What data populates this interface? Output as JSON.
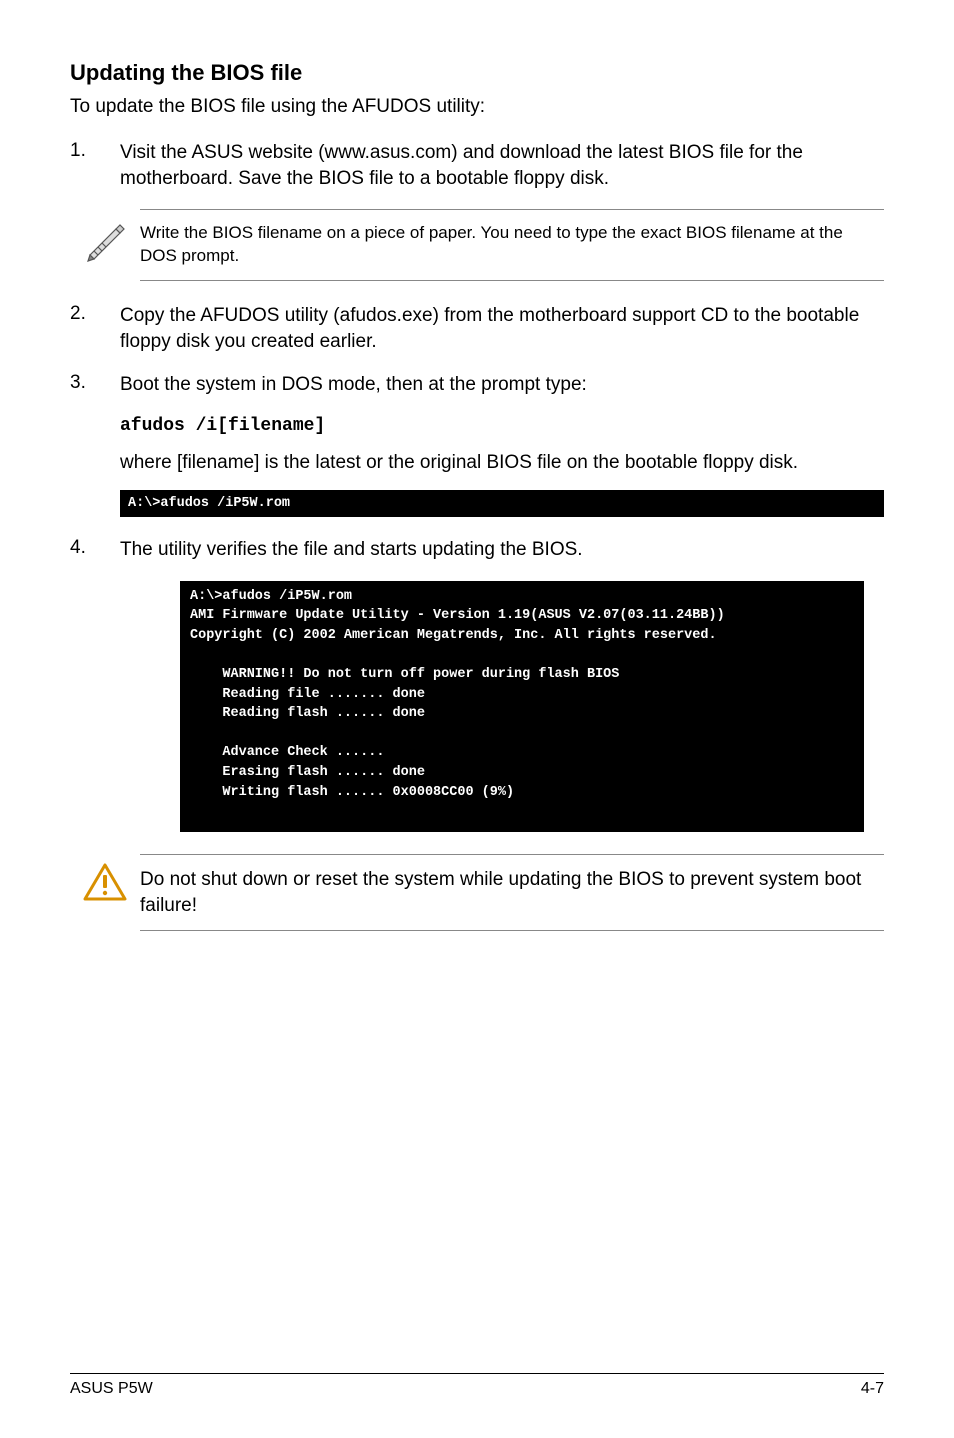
{
  "heading": "Updating the BIOS file",
  "intro": "To update the BIOS file using the AFUDOS utility:",
  "step1": {
    "num": "1.",
    "text": "Visit the ASUS website (www.asus.com) and download the latest BIOS file for the motherboard. Save the BIOS file to a bootable floppy disk."
  },
  "note1": "Write the BIOS filename on a piece of paper. You need to type the exact BIOS filename at the DOS prompt.",
  "step2": {
    "num": "2.",
    "text": "Copy the AFUDOS utility (afudos.exe) from the motherboard support CD to the bootable floppy disk you created earlier."
  },
  "step3": {
    "num": "3.",
    "text": "Boot the system in DOS mode, then at the prompt type:"
  },
  "code1": "afudos /i[filename]",
  "step3b": "where [filename] is the latest or the original BIOS file on the bootable floppy disk.",
  "terminal1": "A:\\>afudos /iP5W.rom",
  "step4": {
    "num": "4.",
    "text": "The utility verifies the file and starts updating the BIOS."
  },
  "terminal2": "A:\\>afudos /iP5W.rom\nAMI Firmware Update Utility - Version 1.19(ASUS V2.07(03.11.24BB))\nCopyright (C) 2002 American Megatrends, Inc. All rights reserved.\n\n    WARNING!! Do not turn off power during flash BIOS\n    Reading file ....... done\n    Reading flash ...... done\n\n    Advance Check ......\n    Erasing flash ...... done\n    Writing flash ...... 0x0008CC00 (9%)",
  "warning": "Do not shut down or reset the system while updating the BIOS to prevent system boot failure!",
  "footer_left": "ASUS P5W",
  "footer_right": "4-7"
}
